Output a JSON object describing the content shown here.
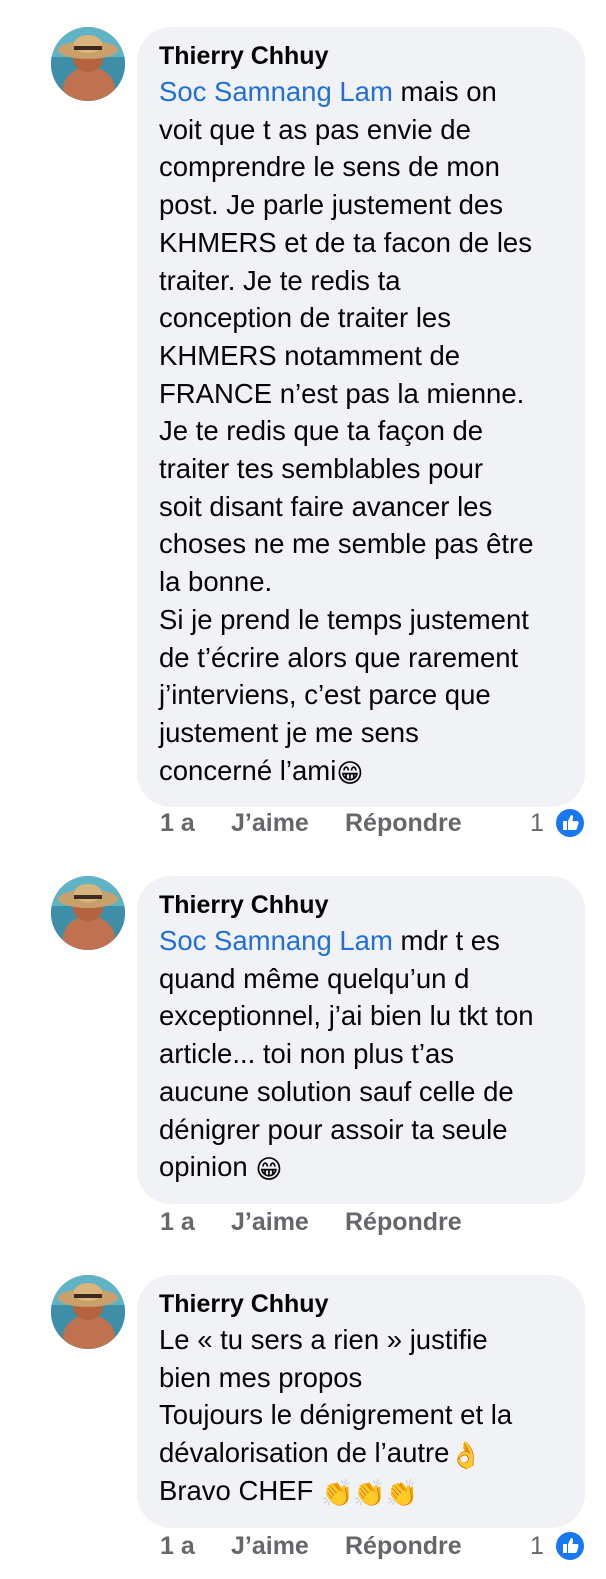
{
  "comments": [
    {
      "author": "Thierry Chhuy",
      "mention": "Soc Samnang Lam",
      "lines": [
        " mais on",
        "voit que t as pas envie de",
        "comprendre le sens de mon",
        "post. Je parle justement des",
        "KHMERS et de ta facon de les",
        "traiter. Je te redis ta",
        "conception de traiter les",
        "KHMERS notamment de",
        "FRANCE n’est pas la mienne.",
        "Je te redis que ta façon de",
        "traiter tes semblables pour",
        "soit disant faire avancer les",
        "choses ne me semble pas être",
        "la bonne.",
        "Si je prend le temps justement",
        "de t’écrire alors que rarement",
        "j’interviens, c’est parce que",
        "justement je me sens",
        "concerné l’ami"
      ],
      "trailing_emoji": "😁",
      "time": "1 a",
      "like_label": "J’aime",
      "reply_label": "Répondre",
      "reaction_count": "1",
      "reaction_icon": "like-icon"
    },
    {
      "author": "Thierry Chhuy",
      "mention": "Soc Samnang Lam",
      "lines": [
        " mdr t es",
        "quand même quelqu’un d",
        "exceptionnel, j’ai bien lu tkt ton",
        "article... toi non plus t’as",
        "aucune solution sauf celle de",
        "dénigrer pour assoir ta seule",
        "opinion "
      ],
      "trailing_emoji": "😁",
      "time": "1 a",
      "like_label": "J’aime",
      "reply_label": "Répondre"
    },
    {
      "author": "Thierry Chhuy",
      "lines": [
        "Le « tu sers a rien » justifie",
        "bien mes propos",
        "Toujours le dénigrement et la",
        "dévalorisation de l’autre"
      ],
      "line4_emoji": "👌",
      "last_line": "Bravo CHEF ",
      "last_emojis": "👏👏👏",
      "time": "1 a",
      "like_label": "J’aime",
      "reply_label": "Répondre",
      "reaction_count": "1",
      "reaction_icon": "like-icon"
    }
  ],
  "colors": {
    "bubble": "#f0f2f5",
    "mention": "#216fdb",
    "meta": "#65676b",
    "like_badge": "#1877f2"
  }
}
